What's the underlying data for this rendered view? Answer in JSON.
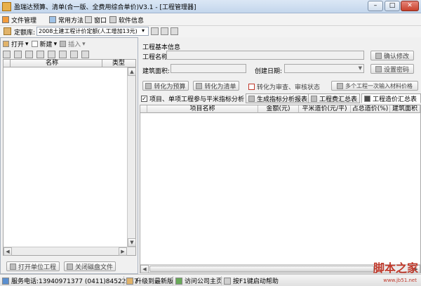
{
  "window": {
    "title": "盈瑞达预算、清单(合一版、全费用综合单价)V3.1 - [工程管理器]",
    "min": "–",
    "restore": "□",
    "close": "✕"
  },
  "menu": {
    "items": [
      "文件管理",
      "常用方法",
      "窗口",
      "软件信息"
    ]
  },
  "quota_bar": {
    "label": "定额库:",
    "value": "2008土建工程计价定额(人工增加13元)",
    "arrow": "▾"
  },
  "left_toolbar": {
    "open": "打开",
    "new": "新建",
    "insert": "插入",
    "arrow": "▾"
  },
  "left_grid": {
    "col_name": "名称",
    "col_type": "类型"
  },
  "left_buttons": {
    "open_unit": "打开单位工程",
    "close_disk": "关闭磁盘文件"
  },
  "info": {
    "group_title": "工程基本信息",
    "name_label": "工程名称:",
    "area_label": "建筑面积:",
    "date_label": "创建日期:",
    "confirm_btn": "确认修改",
    "password_btn": "设置密码"
  },
  "actions": {
    "to_budget": "转化为预算",
    "to_list": "转化为清单",
    "to_review": "转化为审查、审核状态",
    "batch_price": "多个工程一次输入材料价格"
  },
  "tabs": {
    "unit_tab": "项目、单项工程参与平米指标分析",
    "tab1": "生成指标分析报表",
    "tab2": "工程费汇总表",
    "tab3": "工程造价汇总表"
  },
  "grid": {
    "columns": [
      "项目名称",
      "金额(元)",
      "平米造价(元/平)",
      "占总造价(%)",
      "建筑面积"
    ]
  },
  "status": {
    "phone": "服务电话:13940971377 (0411)84522847",
    "upgrade": "升级到最新版",
    "homepage": "访问公司主页",
    "help": "按F1键启动帮助"
  },
  "watermark": {
    "logo": "脚本之家",
    "site": "www.jb51.net"
  },
  "colors": {
    "accent": "#3a6ea5",
    "brand": "#c0392b"
  }
}
